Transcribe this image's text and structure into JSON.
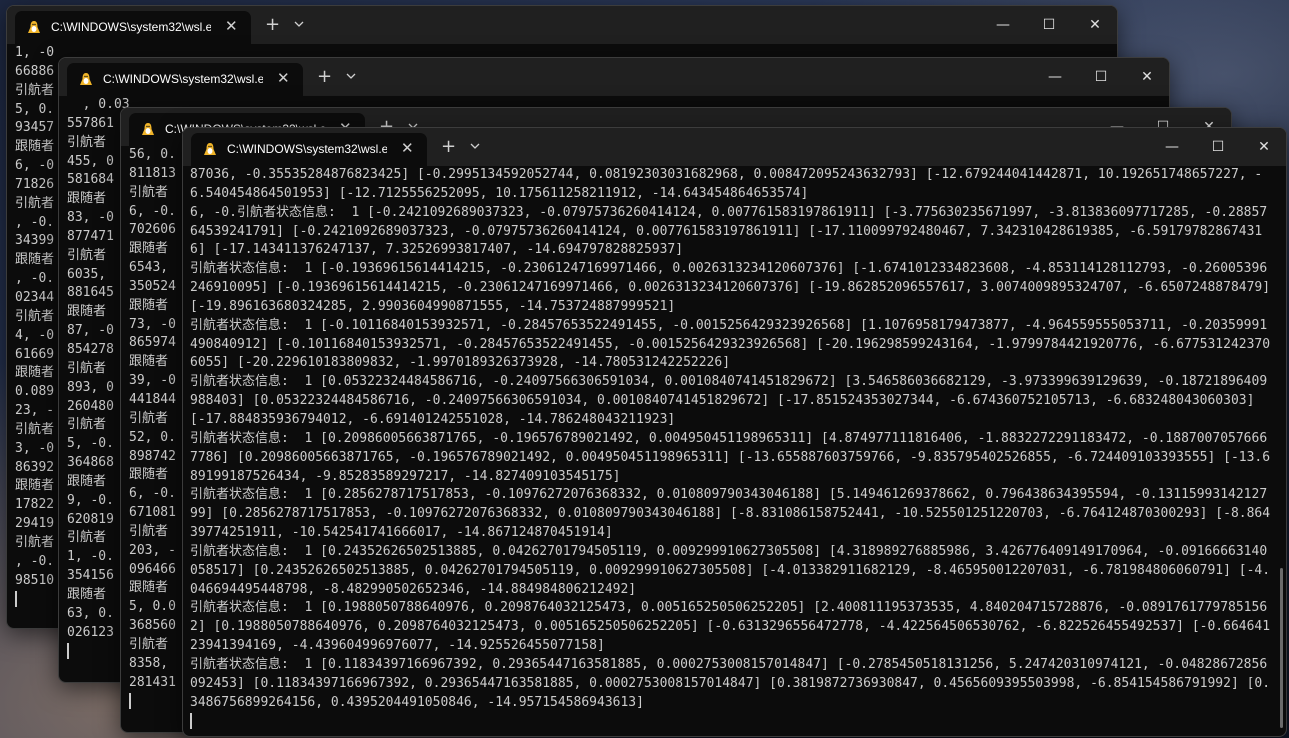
{
  "windows": [
    {
      "tab_title": "C:\\WINDOWS\\system32\\wsl.e",
      "lines": [
        "1, -0",
        "66886",
        "引航者",
        "5, 0.",
        "93457",
        "跟随者",
        "6, -0",
        "71826",
        "引航者",
        ", -0.",
        "34399",
        "跟随者",
        ", -0.",
        "02344",
        "引航者",
        "4, -0",
        "61669",
        "跟随者",
        "0.089",
        "23, -",
        "引航者",
        "3, -0",
        "86392",
        "跟随者",
        "17822",
        "29419",
        "引航者",
        ", -0.",
        "98510",
        ""
      ]
    },
    {
      "tab_title": "C:\\WINDOWS\\system32\\wsl.e",
      "lines": [
        "  , 0.03",
        "557861",
        "引航者",
        "455, 0",
        "581684",
        "跟随者",
        "83, -0",
        "877471",
        "引航者",
        "6035, ",
        "881645",
        "跟随者",
        "87, -0",
        "854278",
        "引航者",
        "893, 0",
        "260480",
        "引航者",
        "5, -0.",
        "364868",
        "跟随者",
        "9, -0.",
        "620819",
        "引航者",
        "1, -0.",
        "354156",
        "跟随者",
        "63, 0.",
        "026123",
        ""
      ]
    },
    {
      "tab_title": "C:\\WINDOWS\\system32\\wsl.e",
      "lines": [
        "56, 0.",
        "811813",
        "引航者",
        "6, -0.",
        "702606",
        "跟随者",
        "6543, ",
        "350524",
        "跟随者",
        "73, -0",
        "865974",
        "跟随者",
        "39, -0",
        "441844",
        "引航者",
        "52, 0.",
        "898742",
        "跟随者",
        "6, -0.",
        "671081",
        "引航者",
        "203, -",
        "096466",
        "跟随者",
        "5, 0.0",
        "368560",
        "引航者",
        "8358, ",
        "281431",
        ""
      ]
    },
    {
      "tab_title": "C:\\WINDOWS\\system32\\wsl.e",
      "lines": [
        "87036, -0.35535284876823425] [-0.2995134592052744, 0.08192303031682968, 0.008472095243632793] [-12.679244041442871, 10.192651748657227, -6.540454864501953] [-12.7125556252095, 10.175611258211912, -14.643454864653574]",
        "6, -0.引航者状态信息:  1 [-0.2421092689037323, -0.07975736260414124, 0.007761583197861911] [-3.775630235671997, -3.813836097717285, -0.2885764539241791] [-0.2421092689037323, -0.07975736260414124, 0.007761583197861911] [-17.110099792480467, 7.342310428619385, -6.591797828674316] [-17.143411376247137, 7.32526993817407, -14.694797828825937]",
        "引航者状态信息:  1 [-0.19369615614414215, -0.23061247169971466, 0.0026313234120607376] [-1.6741012334823608, -4.853114128112793, -0.26005396246910095] [-0.19369615614414215, -0.23061247169971466, 0.0026313234120607376] [-19.862852096557617, 3.0074009895324707, -6.6507248878479] [-19.896163680324285, 2.9903604990871555, -14.753724887999521]",
        "引航者状态信息:  1 [-0.10116840153932571, -0.28457653522491455, -0.0015256429323926568] [1.1076958179473877, -4.964559555053711, -0.20359991490840912] [-0.10116840153932571, -0.28457653522491455, -0.0015256429323926568] [-20.196298599243164, -1.9799784421920776, -6.6775312423706055] [-20.229610183809832, -1.9970189326373928, -14.780531242252226]",
        "引航者状态信息:  1 [0.05322324484586716, -0.24097566306591034, 0.0010840741451829672] [3.546586036682129, -3.973399639129639, -0.18721896409988403] [0.05322324484586716, -0.24097566306591034, 0.0010840741451829672] [-17.851524353027344, -6.674360752105713, -6.683248043060303] [-17.884835936794012, -6.691401242551028, -14.786248043211923]",
        "引航者状态信息:  1 [0.20986005663871765, -0.196576789021492, 0.004950451198965311] [4.874977111816406, -1.8832272291183472, -0.18870070576667786] [0.20986005663871765, -0.196576789021492, 0.004950451198965311] [-13.655887603759766, -9.835795402526855, -6.724409103393555] [-13.689199187526434, -9.85283589297217, -14.827409103545175]",
        "引航者状态信息:  1 [0.2856278717517853, -0.10976272076368332, 0.010809790343046188] [5.149461269378662, 0.796438634395594, -0.1311599314212799] [0.2856278717517853, -0.10976272076368332, 0.010809790343046188] [-8.831086158752441, -10.525501251220703, -6.764124870300293] [-8.86439774251911, -10.542541741666017, -14.867124870451914]",
        "引航者状态信息:  1 [0.24352626502513885, 0.04262701794505119, 0.009299910627305508] [4.318989276885986, 3.426776409149170964, -0.09166663140058517] [0.24352626502513885, 0.04262701794505119, 0.009299910627305508] [-4.013382911682129, -8.465950012207031, -6.781984806060791] [-4.046694495448798, -8.482990502652346, -14.884984806212492]",
        "引航者状态信息:  1 [0.1988050788640976, 0.2098764032125473, 0.005165250506252205] [2.400811195373535, 4.840204715728876, -0.08917617797851562] [0.1988050788640976, 0.2098764032125473, 0.005165250506252205] [-0.6313296556472778, -4.422564506530762, -6.822526455492537] [-0.66464123941394169, -4.439604996976077, -14.925526455077158]",
        "引航者状态信息:  1 [0.11834397166967392, 0.29365447163581885, 0.0002753008157014847] [-0.2785450518131256, 5.247420310974121, -0.04828672856092453] [0.11834397166967392, 0.29365447163581885, 0.0002753008157014847] [0.3819872736930847, 0.4565609395503998, -6.854154586791992] [0.3486756899264156, 0.4395204491050846, -14.957154586943613]",
        ""
      ]
    }
  ],
  "controls": {
    "new_tab": "+",
    "close_tab": "✕",
    "minimize": "—",
    "maximize": "☐",
    "close": "✕"
  }
}
